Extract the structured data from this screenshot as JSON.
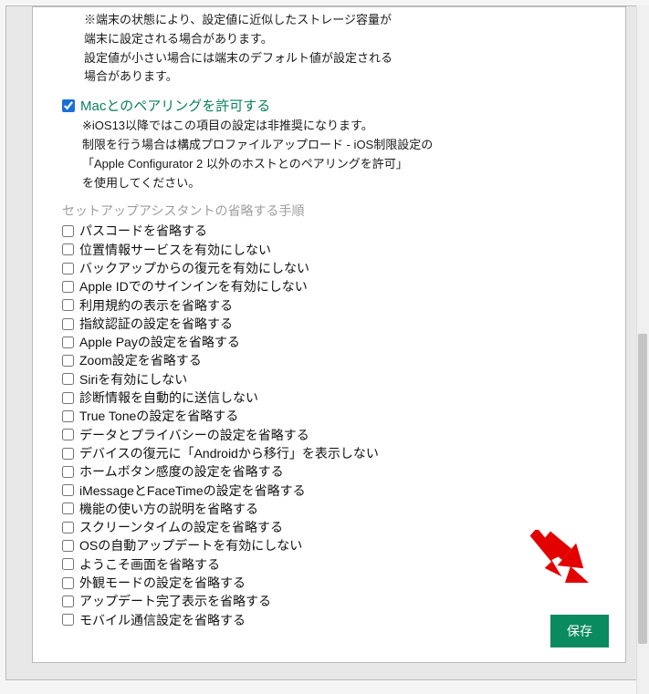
{
  "notes": {
    "storage_note_l1": "※端末の状態により、設定値に近似したストレージ容量が",
    "storage_note_l2": "端末に設定される場合があります。",
    "storage_note_l3": "設定値が小さい場合には端末のデフォルト値が設定される",
    "storage_note_l4": "場合があります。"
  },
  "pairing": {
    "label": "Macとのペアリングを許可する",
    "note_l1": "※iOS13以降ではこの項目の設定は非推奨になります。",
    "note_l2": "制限を行う場合は構成プロファイルアップロード - iOS制限設定の",
    "note_l3": "「Apple Configurator 2 以外のホストとのペアリングを許可」",
    "note_l4": "を使用してください。",
    "checked": true
  },
  "section_header": "セットアップアシスタントの省略する手順",
  "skip_items": [
    {
      "label": "パスコードを省略する"
    },
    {
      "label": "位置情報サービスを有効にしない"
    },
    {
      "label": "バックアップからの復元を有効にしない"
    },
    {
      "label": "Apple IDでのサインインを有効にしない"
    },
    {
      "label": "利用規約の表示を省略する"
    },
    {
      "label": "指紋認証の設定を省略する"
    },
    {
      "label": "Apple Payの設定を省略する"
    },
    {
      "label": "Zoom設定を省略する"
    },
    {
      "label": "Siriを有効にしない"
    },
    {
      "label": "診断情報を自動的に送信しない"
    },
    {
      "label": "True Toneの設定を省略する"
    },
    {
      "label": "データとプライバシーの設定を省略する"
    },
    {
      "label": "デバイスの復元に「Androidから移行」を表示しない"
    },
    {
      "label": "ホームボタン感度の設定を省略する"
    },
    {
      "label": "iMessageとFaceTimeの設定を省略する"
    },
    {
      "label": "機能の使い方の説明を省略する"
    },
    {
      "label": "スクリーンタイムの設定を省略する"
    },
    {
      "label": "OSの自動アップデートを有効にしない"
    },
    {
      "label": "ようこそ画面を省略する"
    },
    {
      "label": "外観モードの設定を省略する"
    },
    {
      "label": "アップデート完了表示を省略する"
    },
    {
      "label": "モバイル通信設定を省略する"
    }
  ],
  "buttons": {
    "save": "保存"
  }
}
